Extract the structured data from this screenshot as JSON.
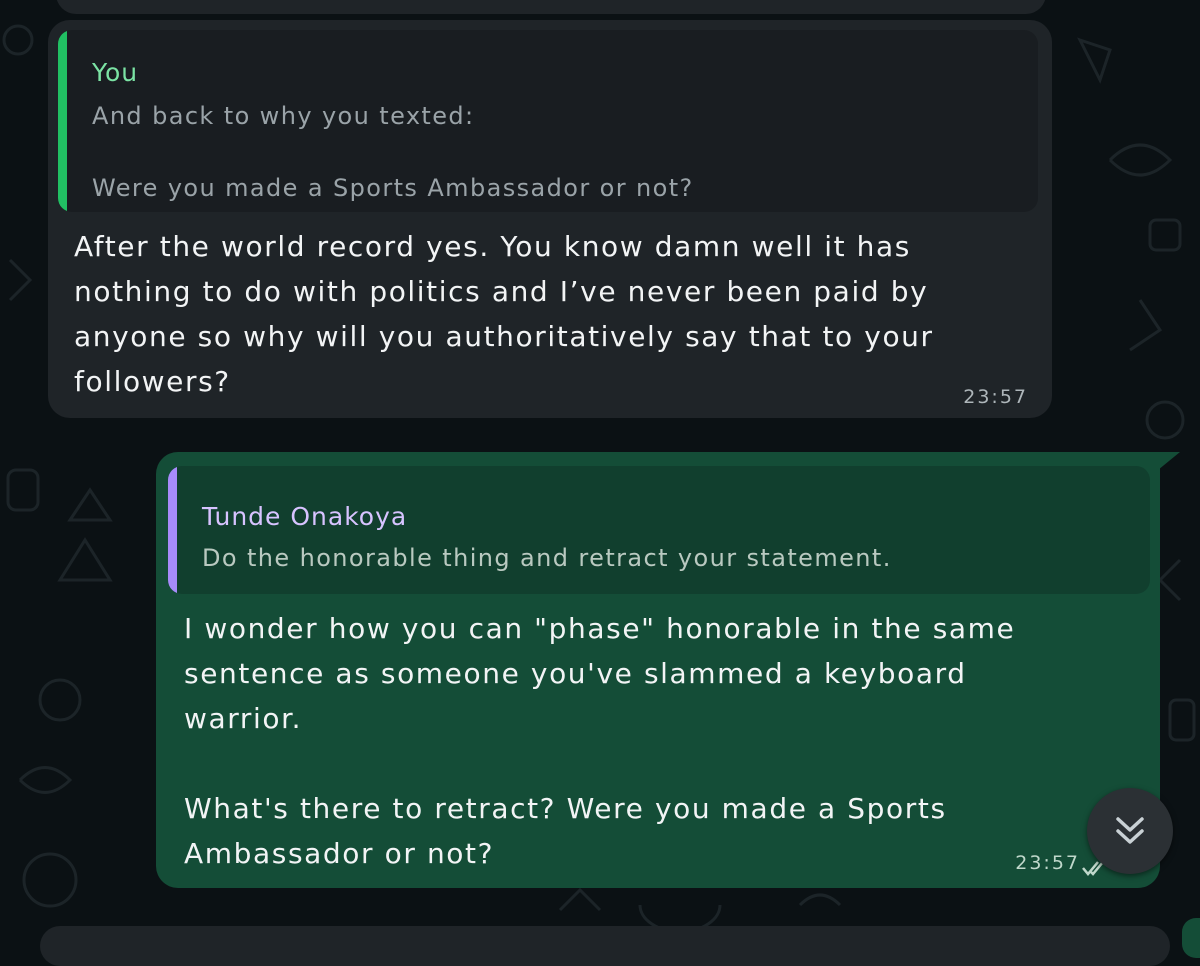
{
  "messages": {
    "incoming": {
      "quote_author": "You",
      "quote_text": "And back to why you texted:\n\nWere you made a Sports Ambassador or not?",
      "text": "After the world record yes. You know damn well it has\nnothing to do with politics and I’ve never been paid by\nanyone so why will you authoritatively say that to your\nfollowers?",
      "time": "23:57"
    },
    "outgoing": {
      "quote_author": "Tunde Onakoya",
      "quote_text": "Do the honorable thing and retract your statement.",
      "text": "I wonder how you can \"phase\" honorable     in the same\nsentence as someone you've slammed a keyboard\nwarrior.\n\nWhat's there to retract? Were you made a Sports\nAmbassador or not?",
      "time": "23:57",
      "status_icon": "double-check-icon"
    }
  },
  "scroll_button": {
    "icon": "chevron-double-down-icon"
  },
  "colors": {
    "background": "#0b1114",
    "incoming_bubble": "#1f2428",
    "outgoing_bubble": "#144d37",
    "incoming_quote_bar": "#21c063",
    "outgoing_quote_bar": "#a78bfa"
  }
}
